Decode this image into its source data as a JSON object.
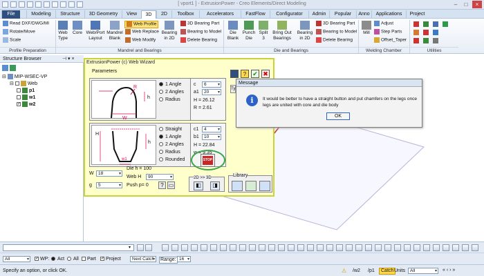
{
  "window": {
    "title": "[ vport1 ] - ExtrusionPower - Creo Elements/Direct Modeling"
  },
  "tabs": [
    "File",
    "Modeling",
    "Structure",
    "3D Geometry",
    "View",
    "3D",
    "2D",
    "Toolbox",
    "Accelerators",
    "FastFlow",
    "Configurator",
    "Admin",
    "Popular",
    "Anno",
    "Applications",
    "Project"
  ],
  "active_tab": "3D",
  "ribbon": {
    "profile_prep": {
      "items": [
        "Read DXF/DWG/MI",
        "Rotate/Move",
        "Scale"
      ],
      "label": "Profile Preparation"
    },
    "mandrel": {
      "buttons": [
        "Web\nType",
        "Core",
        "Web/Port\nLayout",
        "Mandrel\nBlank"
      ],
      "web_items": [
        "Web Profile",
        "Web Replace",
        "Web Modify"
      ],
      "bearing2d": "Bearing\nin 2D",
      "bearing_items": [
        "3D Bearing Part",
        "Bearing to Model",
        "Delete Bearing"
      ],
      "label": "Mandrel and Bearings"
    },
    "die": {
      "buttons": [
        "Die\nBlank",
        "Punch\nDie",
        "Split\n3",
        "Bring Out\nBearings",
        "Bearing\nin 2D"
      ],
      "bearing_items": [
        "3D Bearing Part",
        "Bearing to Model",
        "Delete Bearing"
      ],
      "label": "Die and Bearings"
    },
    "welding": {
      "mill": "Mill",
      "items": [
        "Adjust",
        "Step Parts",
        "Offset_Taper"
      ],
      "label": "Welding Chamber"
    },
    "utilities": {
      "label": "Utilities"
    }
  },
  "structure_browser": {
    "title": "Structure Browser",
    "root": "MIP-WSEC-VP",
    "items": [
      "Web",
      "p1",
      "w1",
      "w2"
    ]
  },
  "wizard": {
    "title": "ExtrusionPower (c) Web Wizard",
    "params_label": "Parameters",
    "top": {
      "radios": [
        "1 Angle",
        "2 Angles",
        "Radius"
      ],
      "selected": "1 Angle",
      "c_label": "c",
      "c_value": "6",
      "a1_label": "a1",
      "a1_value": "20",
      "H": "H = 26.12",
      "R": "R = 2.61",
      "sketch_labels": {
        "R": "R",
        "h": "h",
        "W": "W"
      }
    },
    "bottom": {
      "radios": [
        "Straight",
        "1 Angle",
        "2 Angles",
        "Radius",
        "Rounded"
      ],
      "selected": "1 Angle",
      "c1_label": "c1",
      "c1_value": "4",
      "b1_label": "b1",
      "b1_value": "10",
      "H": "H = 22.84",
      "w": "w = 9.35",
      "sketch_labels": {
        "H": "H",
        "h": "h",
        "w1": "w1"
      }
    },
    "W_label": "W",
    "W_value": "18",
    "g_label": "g",
    "g_value": "5",
    "die_h": "Die h = 100",
    "web_h_label": "Web H",
    "web_h_value": "90",
    "push": "Push  p= 0",
    "stop": "STOP",
    "twod3d": "2D >> 3D",
    "library": "Library",
    "ty_tab": "Ty"
  },
  "message": {
    "title": "Message",
    "text": "It would be better to have a straight button and put chamfers on the legs once legs are united with core and die body",
    "ok": "OK"
  },
  "statusbar": {
    "prompt": "Specify an option, or click OK.",
    "filter_all": "All",
    "wp": "WP:",
    "act": "Act",
    "all": "All",
    "part": "Part",
    "project": "Project",
    "next_catch": "Next Catch",
    "range_label": "Range:",
    "range_value": "16",
    "path1": "/w2",
    "path2": "/p1",
    "catch": "Catch",
    "units": "Units",
    "units_value": "All"
  },
  "colors": {
    "accent": "#2d63c8",
    "wizard_bg": "#ffffcc",
    "wizard_border": "#c9d23a",
    "arrow": "#c0392b",
    "circle": "#3aa64a"
  }
}
